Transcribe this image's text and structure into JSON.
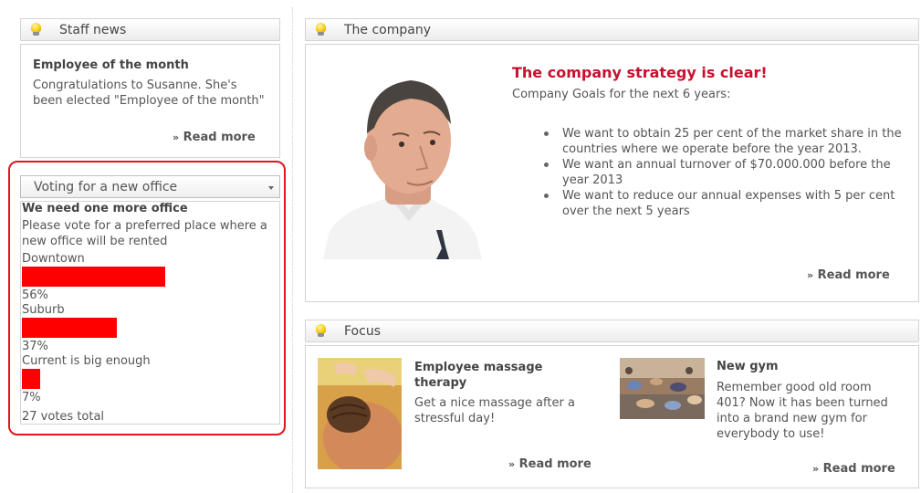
{
  "staff_news": {
    "header": "Staff news",
    "headline": "Employee of the month",
    "text": "Congratulations to Susanne. She's been elected \"Employee of the month\"",
    "read_more": "Read more"
  },
  "poll": {
    "selected": "Voting for a new office",
    "question": "We need one more office",
    "prompt": "Please vote for a preferred place where a new office will be rented",
    "options": [
      {
        "label": "Downtown",
        "percent_text": "56%",
        "percent": 56
      },
      {
        "label": "Suburb",
        "percent_text": "37%",
        "percent": 37
      },
      {
        "label": "Current is big enough",
        "percent_text": "7%",
        "percent": 7
      }
    ],
    "total": "27 votes total",
    "bar_color": "#ff0000"
  },
  "company": {
    "header": "The company",
    "headline": "The company strategy is clear!",
    "subtitle": "Company Goals for the next 6 years:",
    "goals": [
      "We want to obtain 25 per cent of the market share in the countries where we operate before the year 2013.",
      "We want an annual turnover of $70.000.000 before the year 2013",
      "We want to reduce our annual expenses with 5 per cent over the next 5 years"
    ],
    "read_more": "Read more",
    "headline_color": "#c8102e"
  },
  "focus": {
    "header": "Focus",
    "items": [
      {
        "title": "Employee massage therapy",
        "text": "Get a nice massage after a stressful day!",
        "read_more": "Read more"
      },
      {
        "title": "New gym",
        "text": "Remember good old room 401? Now it has been turned into a brand new gym for everybody to use!",
        "read_more": "Read more"
      }
    ]
  },
  "icons": {
    "widget_icon": "lightbulb-icon",
    "dropdown": "chevron-down-icon",
    "read_more": "double-chevron-right-icon"
  }
}
